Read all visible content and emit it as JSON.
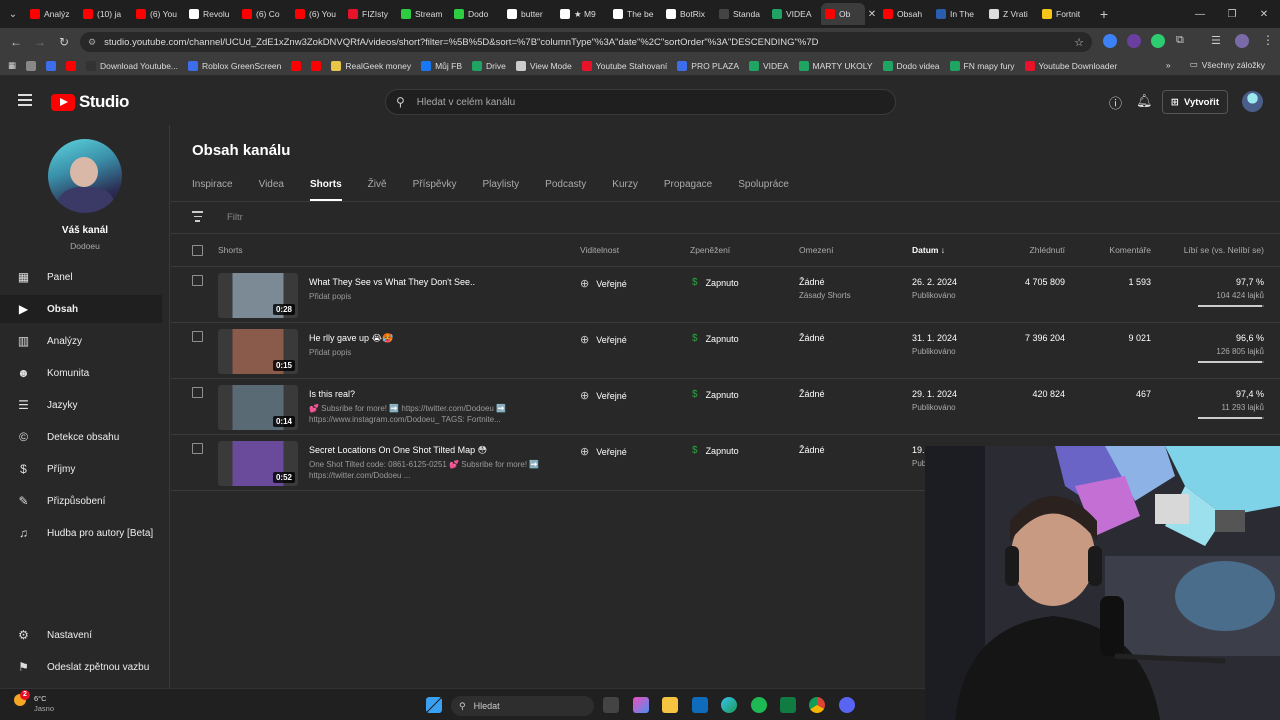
{
  "browser": {
    "tabs": [
      {
        "label": "Analýz",
        "color": "#ff0000"
      },
      {
        "label": "(10) ja",
        "color": "#ff0000"
      },
      {
        "label": "(6) You",
        "color": "#ff0000"
      },
      {
        "label": "Revolu",
        "color": "#ffffff"
      },
      {
        "label": "(6) Co",
        "color": "#ff0000"
      },
      {
        "label": "(6) You",
        "color": "#ff0000"
      },
      {
        "label": "FIZIsty",
        "color": "#e8132b"
      },
      {
        "label": "Stream",
        "color": "#2ecc40"
      },
      {
        "label": "Dodo",
        "color": "#2ecc40"
      },
      {
        "label": "butter",
        "color": "#ffffff"
      },
      {
        "label": "★ M9",
        "color": "#ffffff"
      },
      {
        "label": "The be",
        "color": "#ffffff"
      },
      {
        "label": "BotRix",
        "color": "#ffffff"
      },
      {
        "label": "Standa",
        "color": "#444444"
      },
      {
        "label": "VIDEA",
        "color": "#1fa463"
      },
      {
        "label": "Ob",
        "color": "#ff0000",
        "active": true
      },
      {
        "label": "Obsah",
        "color": "#ff0000"
      },
      {
        "label": "In The",
        "color": "#2a5db0"
      },
      {
        "label": "Z Vrati",
        "color": "#dddddd"
      },
      {
        "label": "Fortnit",
        "color": "#f5c518"
      }
    ],
    "url": "studio.youtube.com/channel/UCUd_ZdE1xZnw3ZokDNVQRfA/videos/short?filter=%5B%5D&sort=%7B\"columnType\"%3A\"date\"%2C\"sortOrder\"%3A\"DESCENDING\"%7D",
    "bookmarks": [
      {
        "label": "",
        "color": "#888888"
      },
      {
        "label": "",
        "color": "#3b6ee8"
      },
      {
        "label": "",
        "color": "#ff0000"
      },
      {
        "label": "Download Youtube...",
        "color": "#333333"
      },
      {
        "label": "Roblox GreenScreen",
        "color": "#3b6ee8"
      },
      {
        "label": "",
        "color": "#ff0000"
      },
      {
        "label": "",
        "color": "#ff0000"
      },
      {
        "label": "RealGeek money",
        "color": "#e8c547"
      },
      {
        "label": "Můj FB",
        "color": "#1877f2"
      },
      {
        "label": "Drive",
        "color": "#1fa463"
      },
      {
        "label": "View Mode",
        "color": "#cccccc"
      },
      {
        "label": "Youtube Stahovaní",
        "color": "#e8132b"
      },
      {
        "label": "PRO PLAZA",
        "color": "#3b6ee8"
      },
      {
        "label": "VIDEA",
        "color": "#1fa463"
      },
      {
        "label": "MARTY UKOLY",
        "color": "#1fa463"
      },
      {
        "label": "Dodo videa",
        "color": "#1fa463"
      },
      {
        "label": "FN mapy fury",
        "color": "#1fa463"
      },
      {
        "label": "Youtube Downloader",
        "color": "#e8132b"
      }
    ],
    "bookmarks_folder": "Všechny záložky"
  },
  "studio": {
    "logo_text": "Studio",
    "search_placeholder": "Hledat v celém kanálu",
    "create_label": "Vytvořit"
  },
  "sidebar": {
    "channel_name": "Váš kanál",
    "channel_handle": "Dodoeu",
    "items": [
      {
        "label": "Panel",
        "icon": "▦"
      },
      {
        "label": "Obsah",
        "icon": "▶",
        "active": true
      },
      {
        "label": "Analýzy",
        "icon": "▥"
      },
      {
        "label": "Komunita",
        "icon": "☻"
      },
      {
        "label": "Jazyky",
        "icon": "☰"
      },
      {
        "label": "Detekce obsahu",
        "icon": "©"
      },
      {
        "label": "Příjmy",
        "icon": "$"
      },
      {
        "label": "Přizpůsobení",
        "icon": "✎"
      },
      {
        "label": "Hudba pro autory [Beta]",
        "icon": "♫"
      }
    ],
    "settings_label": "Nastavení",
    "feedback_label": "Odeslat zpětnou vazbu"
  },
  "main": {
    "title": "Obsah kanálu",
    "tabs": [
      "Inspirace",
      "Videa",
      "Shorts",
      "Živě",
      "Příspěvky",
      "Playlisty",
      "Podcasty",
      "Kurzy",
      "Propagace",
      "Spolupráce"
    ],
    "active_tab": "Shorts",
    "filter_placeholder": "Filtr",
    "columns": {
      "shorts": "Shorts",
      "visibility": "Viditelnost",
      "monetization": "Zpeněžení",
      "restrictions": "Omezení",
      "date": "Datum ↓",
      "views": "Zhlédnutí",
      "comments": "Komentáře",
      "likes": "Líbí se (vs. Nelíbí se)"
    },
    "rows": [
      {
        "title": "What They See vs What They Don't See..",
        "description": "Přidat popis",
        "duration": "0:28",
        "visibility": "Veřejné",
        "monetization": "Zapnuto",
        "restriction": "Žádné",
        "restriction_sub": "Zásady Shorts",
        "date": "26. 2. 2024",
        "date_sub": "Publikováno",
        "views": "4 705 809",
        "comments": "1 593",
        "likes_pct": "97,7 %",
        "likes_count": "104 424 lajků",
        "likes_ratio": 0.977,
        "thumb_color": "#7b8a94"
      },
      {
        "title": "He rlly gave up 😭🥵",
        "description": "Přidat popis",
        "duration": "0:15",
        "visibility": "Veřejné",
        "monetization": "Zapnuto",
        "restriction": "Žádné",
        "restriction_sub": "",
        "date": "31. 1. 2024",
        "date_sub": "Publikováno",
        "views": "7 396 204",
        "comments": "9 021",
        "likes_pct": "96,6 %",
        "likes_count": "126 805 lajků",
        "likes_ratio": 0.966,
        "thumb_color": "#8a5a4a"
      },
      {
        "title": "Is this real?",
        "description": "💕 Subsribe for more! ➡️ https://twitter.com/Dodoeu ➡️ https://www.instagram.com/Dodoeu_ TAGS: Fortnite...",
        "duration": "0:14",
        "visibility": "Veřejné",
        "monetization": "Zapnuto",
        "restriction": "Žádné",
        "restriction_sub": "",
        "date": "29. 1. 2024",
        "date_sub": "Publikováno",
        "views": "420 824",
        "comments": "467",
        "likes_pct": "97,4 %",
        "likes_count": "11 293 lajků",
        "likes_ratio": 0.974,
        "thumb_color": "#5a6a74"
      },
      {
        "title": "Secret Locations On One Shot Tilted Map 😳",
        "description": "One Shot Tilted code: 0861-6125-0251 💕 Subsribe for more! ➡️ https://twitter.com/Dodoeu ...",
        "duration": "0:52",
        "visibility": "Veřejné",
        "monetization": "Zapnuto",
        "restriction": "Žádné",
        "restriction_sub": "",
        "date": "19.",
        "date_sub": "Pub",
        "views": "",
        "comments": "",
        "likes_pct": "",
        "likes_count": "",
        "likes_ratio": 0,
        "thumb_color": "#6a4a9a"
      }
    ]
  },
  "taskbar": {
    "weather_temp": "6°C",
    "weather_desc": "Jasno",
    "weather_badge": "2",
    "search_placeholder": "Hledat"
  }
}
